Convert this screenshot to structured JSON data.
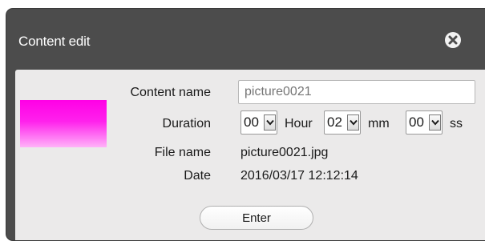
{
  "dialog": {
    "title": "Content edit",
    "close_icon": "close-circle-icon"
  },
  "thumbnail": {
    "colors": [
      "#ff00e6",
      "#ffb3f8"
    ]
  },
  "form": {
    "content_name_label": "Content name",
    "content_name_placeholder": "picture0021",
    "duration_label": "Duration",
    "hour_value": "00",
    "hour_unit": "Hour",
    "minute_value": "02",
    "minute_unit": "mm",
    "second_value": "00",
    "second_unit": "ss",
    "file_name_label": "File name",
    "file_name_value": "picture0021.jpg",
    "date_label": "Date",
    "date_value": "2016/03/17 12:12:14"
  },
  "actions": {
    "enter_label": "Enter"
  }
}
